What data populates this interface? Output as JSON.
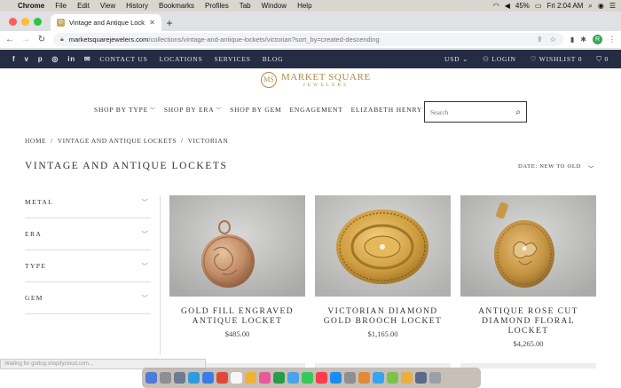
{
  "menubar": {
    "app": "Chrome",
    "items": [
      "File",
      "Edit",
      "View",
      "History",
      "Bookmarks",
      "Profiles",
      "Tab",
      "Window",
      "Help"
    ],
    "battery": "45%",
    "clock": "Fri 2:04 AM"
  },
  "browser": {
    "tab_title": "Vintage and Antique Lockets",
    "url_host": "marketsquarejewelers.com",
    "url_path": "/collections/vintage-and-antique-lockets/victorian?sort_by=created-descending",
    "profile_initial": "R"
  },
  "topnav": {
    "links": [
      "CONTACT US",
      "LOCATIONS",
      "SERVICES",
      "BLOG"
    ],
    "currency": "USD",
    "login": "LOGIN",
    "wishlist": "WISHLIST",
    "wishlist_count": "0",
    "cart_count": "0"
  },
  "logo": {
    "name": "MARKET SQUARE",
    "sub": "JEWELERS"
  },
  "catnav": {
    "items": [
      "SHOP BY TYPE",
      "SHOP BY ERA",
      "SHOP BY GEM",
      "ENGAGEMENT",
      "ELIZABETH HENRY"
    ]
  },
  "search": {
    "placeholder": "Search"
  },
  "breadcrumb": [
    "HOME",
    "VINTAGE AND ANTIQUE LOCKETS",
    "VICTORIAN"
  ],
  "page_title": "VINTAGE AND ANTIQUE LOCKETS",
  "sort": {
    "label": "DATE: NEW TO OLD"
  },
  "filters": [
    "METAL",
    "ERA",
    "TYPE",
    "GEM"
  ],
  "products": [
    {
      "name": "GOLD FILL ENGRAVED ANTIQUE LOCKET",
      "price": "$485.00"
    },
    {
      "name": "VICTORIAN DIAMOND GOLD BROOCH LOCKET",
      "price": "$1,165.00"
    },
    {
      "name": "ANTIQUE ROSE CUT DIAMOND FLORAL LOCKET",
      "price": "$4,265.00"
    }
  ],
  "status_text": "Waiting for godog.shopifycloud.com...",
  "colors": {
    "nav_bg": "#252d45",
    "gold": "#b08a45"
  }
}
